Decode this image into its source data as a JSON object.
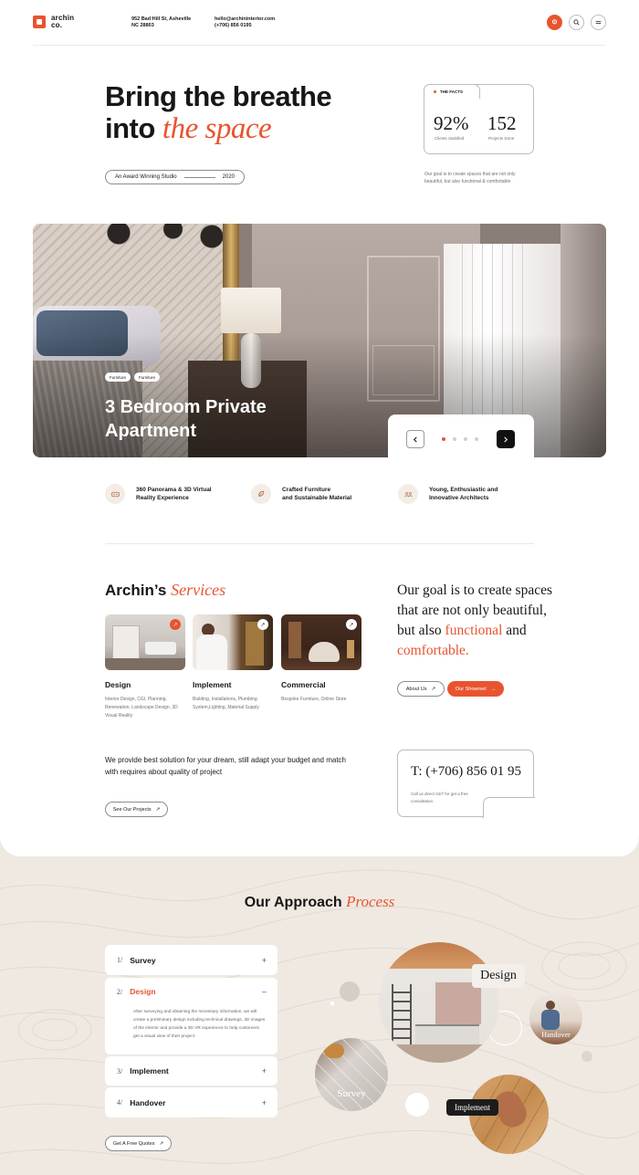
{
  "header": {
    "logo_line1": "archin",
    "logo_line2": "co.",
    "address_line1": "952 Bad Hill St, Asheville",
    "address_line2": "NC 28803",
    "email": "hello@archininterior.com",
    "phone": "(+706) 856 0195"
  },
  "hero": {
    "title_line1": "Bring the breathe",
    "title_line2_plain": "into ",
    "title_line2_accent": "the space",
    "award_label": "An Award Winning Studio",
    "award_year": "2020",
    "facts_label": "THE FACTS",
    "fact1_value": "92%",
    "fact1_label": "Clients Satisfied",
    "fact2_value": "152",
    "fact2_label": "Projects Done",
    "facts_note": "Our goal is to create spaces that are not only beautiful, but also functional & comfortable"
  },
  "slide": {
    "tag1": "Furniture",
    "tag2": "Furniture",
    "caption": "3 Bedroom Private Apartment",
    "active_index": 0,
    "count": 4
  },
  "features": [
    {
      "line1": "360 Panorama & 3D Virtual",
      "line2": "Reality Experience"
    },
    {
      "line1": "Crafted Furniture",
      "line2": "and Sustainable Material"
    },
    {
      "line1": "Young, Enthusiastic and",
      "line2": "Innovative Architects"
    }
  ],
  "services": {
    "title_plain": "Archin’s ",
    "title_accent": "Services",
    "items": [
      {
        "name": "Design",
        "desc": "Interior Design, CGI, Planning, Renewation, Landscape Design, 3D Visual Reality"
      },
      {
        "name": "Implement",
        "desc": "Building, Installations, Plumbing System,Lighting, Material Supply"
      },
      {
        "name": "Commercial",
        "desc": "Bespoke Furniture, Online Store"
      }
    ],
    "goal_part1": "Our goal is to create spaces that are not only beautiful, but also ",
    "goal_accent1": "functional",
    "goal_part2": " and ",
    "goal_accent2": "comfortable.",
    "about_btn": "About Us",
    "showreel_btn": "Our Showreel",
    "solution_text": "We provide best solution for your dream, still adapt your budget and match with requires about quality of project",
    "projects_btn": "See Our Projects",
    "phone_big": "T: (+706) 856 01 95",
    "phone_note": "Call us direct 24/7 for get a free consultation"
  },
  "approach": {
    "title_plain": "Our Approach ",
    "title_accent": "Process",
    "steps": [
      {
        "num": "1/",
        "name": "Survey",
        "toggle": "+"
      },
      {
        "num": "2/",
        "name": "Design",
        "toggle": "–",
        "body": "After surveying and obtaining the necessary information, we will create a preliminary design including technical drawings, 3D images of the interior and provide a 3D VR experience to help customers get a visual view of their project."
      },
      {
        "num": "3/",
        "name": "Implement",
        "toggle": "+"
      },
      {
        "num": "4/",
        "name": "Handover",
        "toggle": "+"
      }
    ],
    "quote_btn": "Get A Free Quotes",
    "labels": {
      "design": "Design",
      "handover": "Handover",
      "survey": "Survey",
      "implement": "Implement"
    }
  },
  "colors": {
    "accent": "#e8542f",
    "ink": "#171717",
    "sand": "#efe9e2"
  },
  "icons": [
    "location-pin-icon",
    "search-icon",
    "menu-icon",
    "arrow-up-right-icon",
    "chevron-left-icon",
    "chevron-right-icon",
    "vr-headset-icon",
    "leaf-icon",
    "team-icon"
  ]
}
